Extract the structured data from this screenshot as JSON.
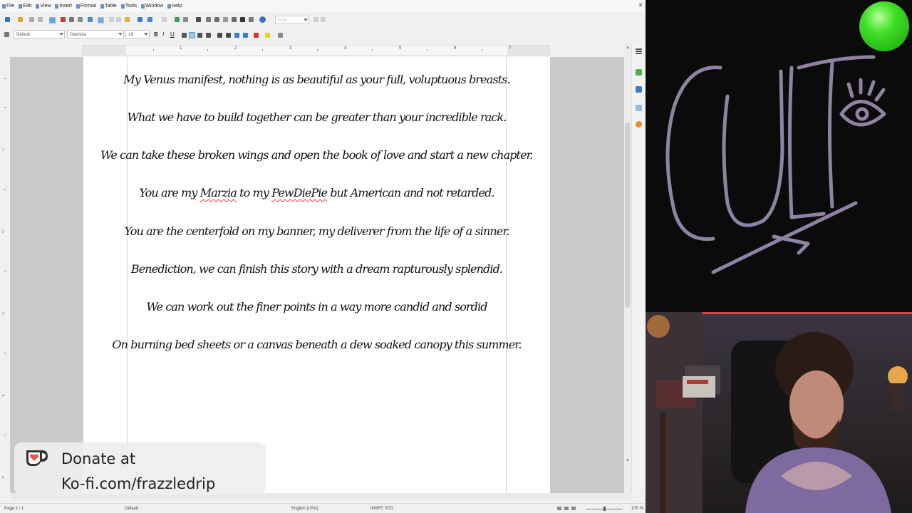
{
  "menu": [
    "File",
    "Edit",
    "View",
    "Insert",
    "Format",
    "Table",
    "Tools",
    "Window",
    "Help"
  ],
  "toolbar": {
    "find_placeholder": "Find",
    "style": "Default",
    "font": "Gabriola",
    "size": "18"
  },
  "format_buttons": {
    "bold": "B",
    "italic": "I",
    "underline": "U"
  },
  "ruler_numbers": [
    "1",
    "2",
    "3",
    "4",
    "5",
    "6",
    "7"
  ],
  "vruler_numbers": [
    "1",
    "2",
    "3",
    "4",
    "5"
  ],
  "document": {
    "lines": [
      "My Venus manifest, nothing is as beautiful as your full, voluptuous breasts.",
      "What we have to build together can be greater than your incredible rack.",
      "We can take these broken wings and open the book of love and start a new chapter.",
      "You are my Marzia to my PewDiePie but American and not retarded.",
      "You are the centerfold on my banner, my deliverer from the life of a sinner.",
      "Benediction, we can finish this story with a dream rapturously splendid.",
      "We can work out the finer points in a way more candid and sordid",
      "On burning bed sheets or a canvas beneath a dew soaked canopy this summer."
    ],
    "line4_parts": [
      "You are my ",
      "Marzia",
      " to my ",
      "PewDiePie",
      " but American and not retarded."
    ]
  },
  "status": {
    "page": "Page 1 / 1",
    "style": "Default",
    "language": "English (USA)",
    "insert_mode": "INSRT",
    "selection_mode": "STD",
    "zoom": "170 %"
  },
  "overlay": {
    "donate_line1": "Donate at",
    "donate_line2": "Ko-fi.com/frazzledrip"
  },
  "logo": {
    "text": "CULT"
  },
  "colors": {
    "kofi_red": "#e2574c",
    "green_dot": "#3fe025"
  }
}
